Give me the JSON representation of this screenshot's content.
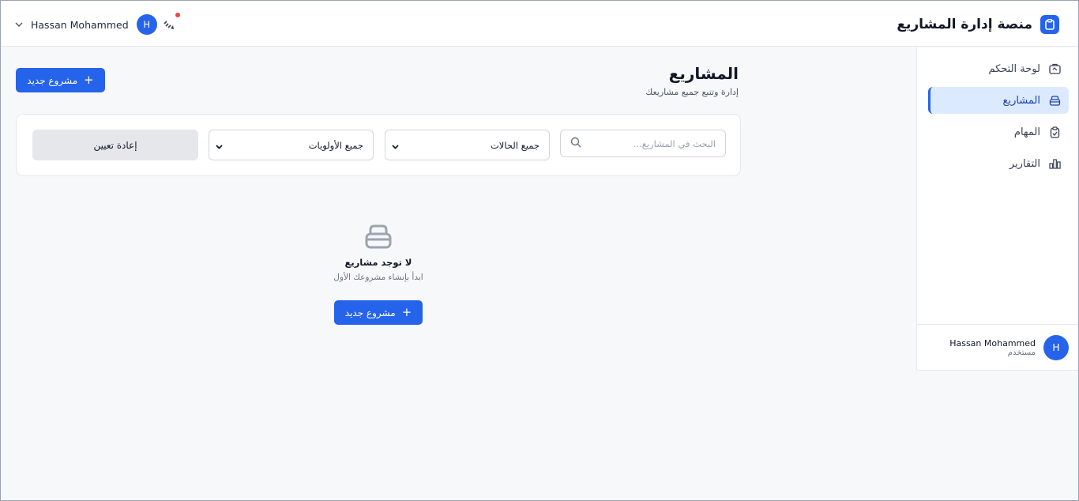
{
  "header": {
    "app_title": "منصة إدارة المشاريع",
    "user_name": "Hassan Mohammed",
    "user_initial": "H"
  },
  "sidebar": {
    "items": [
      {
        "label": "لوحة التحكم",
        "icon": "dashboard-icon",
        "active": false
      },
      {
        "label": "المشاريع",
        "icon": "projects-icon",
        "active": true
      },
      {
        "label": "المهام",
        "icon": "tasks-icon",
        "active": false
      },
      {
        "label": "التقارير",
        "icon": "reports-icon",
        "active": false
      }
    ],
    "user": {
      "name": "Hassan Mohammed",
      "role": "مستخدم",
      "initial": "H"
    }
  },
  "page": {
    "title": "المشاريع",
    "subtitle": "إدارة وتتبع جميع مشاريعك",
    "new_project_label": "مشروع جديد"
  },
  "filters": {
    "search_placeholder": "البحث في المشاريع...",
    "status_value": "جميع الحالات",
    "priority_value": "جميع الأولويات",
    "reset_label": "إعادة تعيين"
  },
  "empty_state": {
    "title": "لا توجد مشاريع",
    "text": "ابدأ بإنشاء مشروعك الأول",
    "button_label": "مشروع جديد"
  },
  "colors": {
    "accent": "#2563eb",
    "active_bg": "#dbeafe",
    "notification": "#ef4444"
  }
}
